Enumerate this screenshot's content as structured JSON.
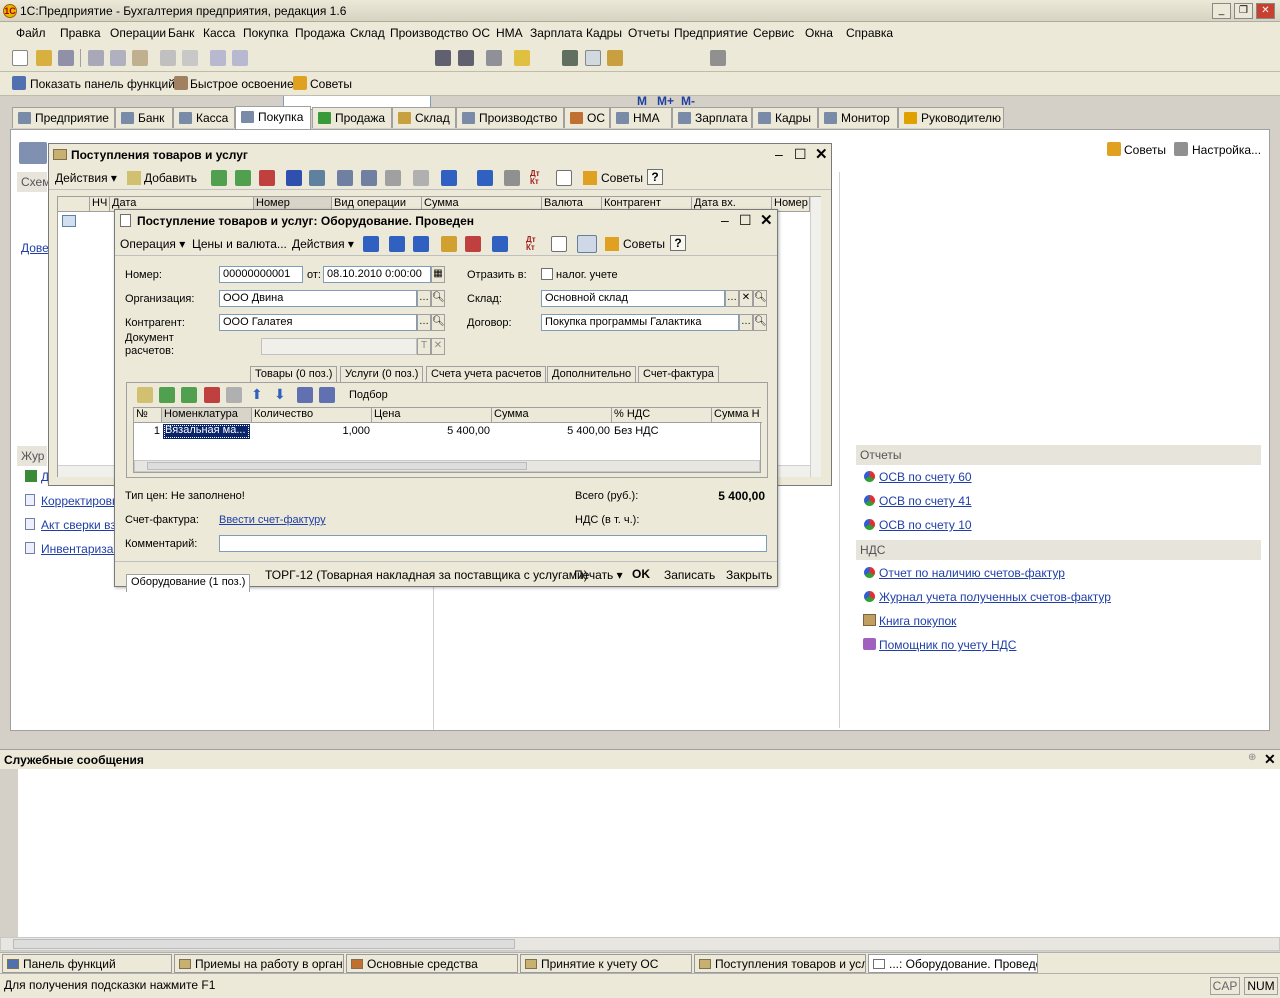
{
  "app": {
    "title": "1С:Предприятие - Бухгалтерия предприятия, редакция 1.6"
  },
  "menu": [
    "Файл",
    "Правка",
    "Операции",
    "Банк",
    "Касса",
    "Покупка",
    "Продажа",
    "Склад",
    "Производство",
    "ОС",
    "НМА",
    "Зарплата",
    "Кадры",
    "Отчеты",
    "Предприятие",
    "Сервис",
    "Окна",
    "Справка"
  ],
  "toolbar2": {
    "show_panel": "Показать панель функций",
    "quick": "Быстрое освоение",
    "tips": "Советы"
  },
  "tabs": [
    "Предприятие",
    "Банк",
    "Касса",
    "Покупка",
    "Продажа",
    "Склад",
    "Производство",
    "ОС",
    "НМА",
    "Зарплата",
    "Кадры",
    "Монитор",
    "Руководителю"
  ],
  "main": {
    "tips": "Советы",
    "settings": "Настройка...",
    "left_cut1": "Схем",
    "left_cut2": "Дове",
    "left_cut3": "Жур",
    "left_cut4": "Д",
    "left_links": [
      "Корректировк",
      "Акт сверки вз",
      "Инвентаризац"
    ],
    "reports_header": "Отчеты",
    "reports": [
      "ОСВ по счету 60",
      "ОСВ по счету 41",
      "ОСВ по счету 10"
    ],
    "vat_header": "НДС",
    "vat": [
      "Отчет по наличию счетов-фактур",
      "Журнал учета полученных счетов-фактур",
      "Книга покупок",
      "Помощник по учету НДС"
    ]
  },
  "list_window": {
    "title": "Поступления товаров и услуг",
    "actions": "Действия",
    "add": "Добавить",
    "tips": "Советы",
    "help": "?",
    "columns": [
      "НЧ",
      "Дата",
      "Номер",
      "Вид операции",
      "Сумма",
      "Валюта",
      "Контрагент",
      "Дата вх.",
      "Номер"
    ]
  },
  "doc": {
    "title": "Поступление товаров и услуг: Оборудование. Проведен",
    "tb": {
      "operation": "Операция",
      "prices": "Цены и валюта...",
      "actions": "Действия",
      "tips": "Советы",
      "help": "?"
    },
    "number_label": "Номер:",
    "number": "00000000001",
    "from_label": "от:",
    "date": "08.10.2010  0:00:00",
    "reflect_label": "Отразить в:",
    "tax_label": "налог. учете",
    "org_label": "Организация:",
    "org": "ООО Двина",
    "warehouse_label": "Склад:",
    "warehouse": "Основной склад",
    "partner_label": "Контрагент:",
    "partner": "ООО Галатея",
    "contract_label": "Договор:",
    "contract": "Покупка программы Галактика",
    "settle_label1": "Документ",
    "settle_label2": "расчетов:",
    "subtabs": [
      "Оборудование (1 поз.)",
      "Товары (0 поз.)",
      "Услуги (0 поз.)",
      "Счета учета расчетов",
      "Дополнительно",
      "Счет-фактура"
    ],
    "pick": "Подбор",
    "grid_cols": [
      "№",
      "Номенклатура",
      "Количество",
      "Цена",
      "Сумма",
      "% НДС",
      "Сумма Н"
    ],
    "rows": [
      {
        "n": "1",
        "item": "Вязальная ма...",
        "qty": "1,000",
        "price": "5 400,00",
        "sum": "5 400,00",
        "vat": "Без НДС"
      }
    ],
    "price_type": "Тип цен: Не заполнено!",
    "total_label": "Всего (руб.):",
    "total": "5 400,00",
    "invoice_label": "Счет-фактура:",
    "invoice_link": "Ввести счет-фактуру",
    "vat_label": "НДС (в т. ч.):",
    "comment_label": "Комментарий:",
    "comment": "",
    "bottom": {
      "torg": "ТОРГ-12 (Товарная накладная за поставщика с услугами)",
      "print": "Печать",
      "ok": "OK",
      "save": "Записать",
      "close": "Закрыть"
    }
  },
  "messages": {
    "title": "Служебные сообщения"
  },
  "taskbar": [
    "Панель функций",
    "Приемы на работу в органи...",
    "Основные средства",
    "Принятие к учету ОС",
    "Поступления товаров и услуг",
    "...: Оборудование. Проведен"
  ],
  "status": {
    "hint": "Для получения подсказки нажмите F1",
    "cap": "CAP",
    "num": "NUM"
  }
}
